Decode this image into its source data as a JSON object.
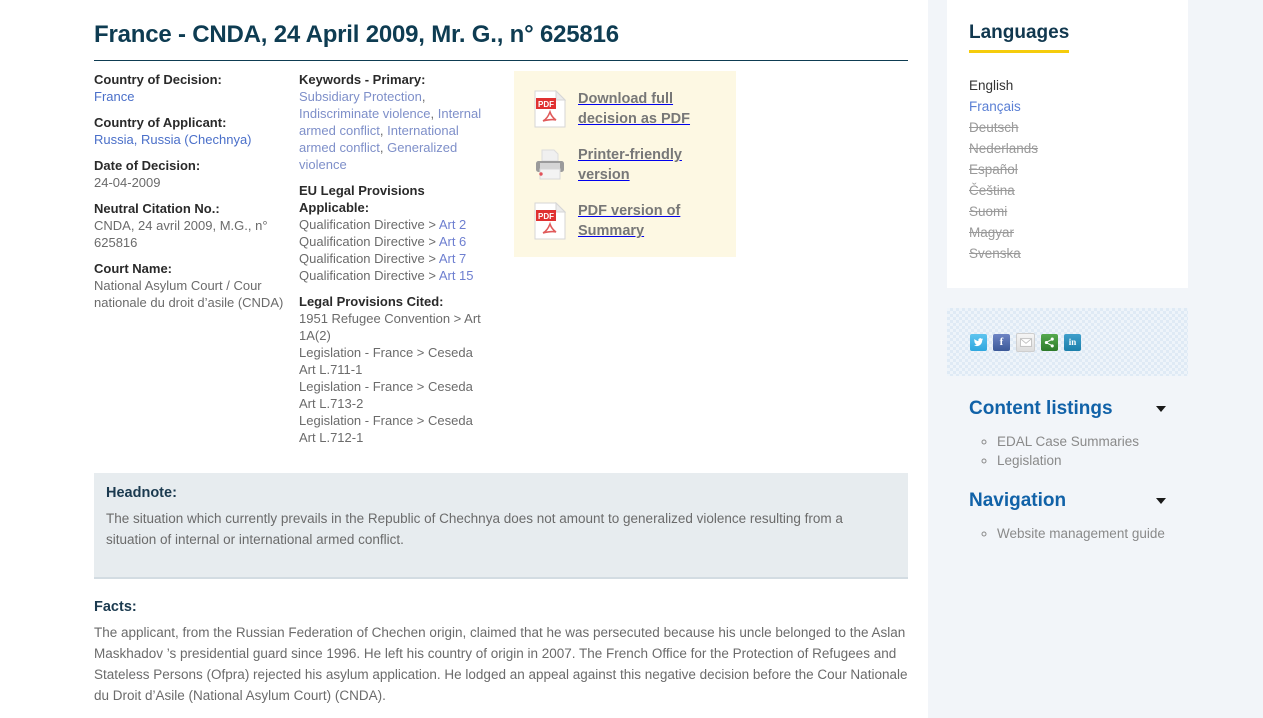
{
  "case": {
    "title": "France - CNDA, 24 April 2009, Mr. G., n° 625816",
    "fields": [
      {
        "label": "Country of Decision:",
        "value": "France",
        "link": true
      },
      {
        "label": "Country of Applicant:",
        "value": "Russia, Russia (Chechnya)",
        "link": true
      },
      {
        "label": "Date of Decision:",
        "value": "24-04-2009",
        "link": false
      },
      {
        "label": "Neutral Citation No.:",
        "value": "CNDA, 24 avril 2009, M.G., n° 625816",
        "link": false
      },
      {
        "label": "Court Name:",
        "value": "National Asylum Court / Cour nationale du droit d’asile (CNDA)",
        "link": false
      }
    ],
    "keywords_label": "Keywords - Primary:",
    "keywords": [
      "Subsidiary Protection",
      "Indiscriminate violence",
      "Internal armed conflict",
      "International armed conflict",
      "Generalized violence"
    ],
    "eu_provisions_label": "EU Legal Provisions Applicable:",
    "eu_provisions": [
      {
        "source": "Qualification Directive > ",
        "art": "Art 2"
      },
      {
        "source": "Qualification Directive > ",
        "art": "Art 6"
      },
      {
        "source": "Qualification Directive > ",
        "art": "Art 7"
      },
      {
        "source": "Qualification Directive > ",
        "art": "Art 15"
      }
    ],
    "cited_label": "Legal Provisions Cited:",
    "cited": [
      "1951 Refugee Convention > Art 1A(2)",
      "Legislation - France > Ceseda Art L.711-1",
      "Legislation - France > Ceseda Art L.713-2",
      "Legislation - France > Ceseda Art L.712-1"
    ],
    "headnote_label": "Headnote:",
    "headnote_text": "The situation which currently prevails in the Republic of Chechnya does not amount to generalized violence resulting from a situation of internal or international armed conflict.",
    "facts_label": "Facts:",
    "facts_text": "The applicant, from the Russian Federation of Chechen origin, claimed that he was persecuted because his uncle belonged to the Aslan Maskhadov ’s  presidential guard since 1996. He left his country of origin in 2007. The French Office for the Protection of Refugees and Stateless Persons (Ofpra) rejected his asylum application. He lodged an appeal against this negative decision before the Cour Nationale du Droit d’Asile (National Asylum Court) (CNDA)."
  },
  "downloads": [
    {
      "icon": "pdf-icon",
      "label": "Download full decision as PDF"
    },
    {
      "icon": "printer-icon",
      "label": "Printer-friendly version"
    },
    {
      "icon": "pdf-icon",
      "label": "PDF version of Summary"
    }
  ],
  "sidebar": {
    "languages_title": "Languages",
    "languages": [
      {
        "label": "English",
        "state": "active"
      },
      {
        "label": "Français",
        "state": "link"
      },
      {
        "label": "Deutsch",
        "state": "disabled"
      },
      {
        "label": "Nederlands",
        "state": "disabled"
      },
      {
        "label": "Español",
        "state": "disabled"
      },
      {
        "label": "Čeština",
        "state": "disabled"
      },
      {
        "label": "Suomi",
        "state": "disabled"
      },
      {
        "label": "Magyar",
        "state": "disabled"
      },
      {
        "label": "Svenska",
        "state": "disabled"
      }
    ],
    "share": [
      {
        "icon": "twitter-icon",
        "glyph": "t"
      },
      {
        "icon": "facebook-icon",
        "glyph": "f"
      },
      {
        "icon": "email-icon",
        "glyph": "✉"
      },
      {
        "icon": "share-icon",
        "glyph": "⇉"
      },
      {
        "icon": "linkedin-icon",
        "glyph": "in"
      }
    ],
    "content_listings_title": "Content listings",
    "content_listings": [
      "EDAL Case Summaries",
      "Legislation"
    ],
    "navigation_title": "Navigation",
    "navigation": [
      "Website management guide"
    ]
  },
  "colors": {
    "title": "#0e3c52",
    "accent_yellow": "#f5cc0c",
    "link_blue": "#4a6fc9",
    "sidebar_heading": "#1162a8",
    "download_box_bg": "#fdf8e3",
    "headnote_bg": "#e7ecef",
    "page_band": "#f2f5f9"
  }
}
